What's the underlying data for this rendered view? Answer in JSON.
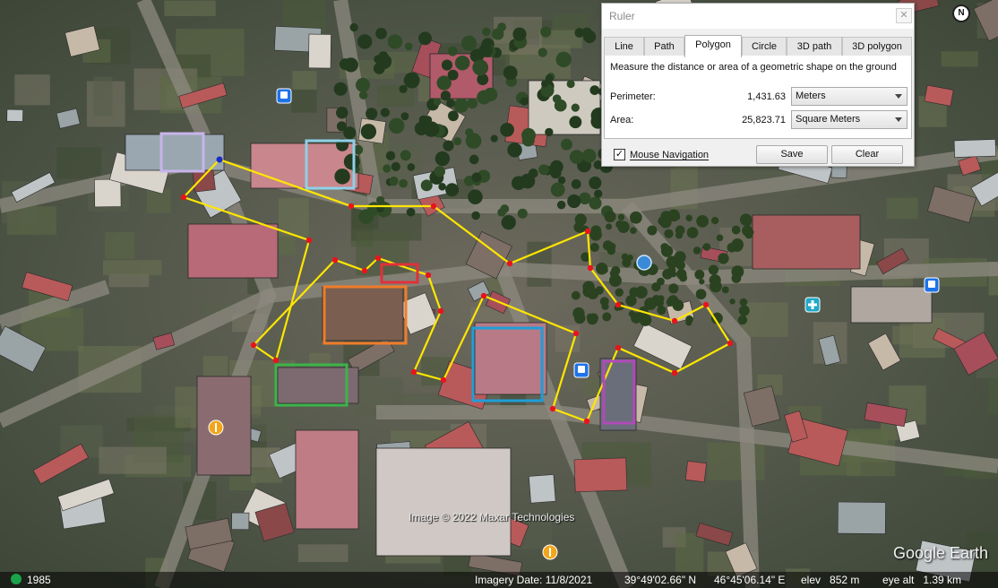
{
  "ruler": {
    "title": "Ruler",
    "close_glyph": "✕",
    "tabs": [
      {
        "label": "Line"
      },
      {
        "label": "Path"
      },
      {
        "label": "Polygon",
        "active": true
      },
      {
        "label": "Circle"
      },
      {
        "label": "3D path"
      },
      {
        "label": "3D polygon"
      }
    ],
    "description": "Measure the distance or area of a geometric shape on the ground",
    "perimeter_label": "Perimeter:",
    "perimeter_value": "1,431.63",
    "perimeter_unit": "Meters",
    "area_label": "Area:",
    "area_value": "25,823.71",
    "area_unit": "Square Meters",
    "mouse_nav_checked": "✓",
    "mouse_nav_label": "Mouse Navigation",
    "save_label": "Save",
    "clear_label": "Clear"
  },
  "map": {
    "compass_label": "N",
    "copyright": "Image © 2022 Maxar Technologies",
    "logo": "Google Earth",
    "polygon_color": "#ffe600",
    "vertex_color": "#e8141c",
    "annotation_colors": [
      "#c8b4ec",
      "#8fd0e8",
      "#e0303a",
      "#f07c2a",
      "#3cb44a",
      "#1e9ed8",
      "#b04ab8"
    ],
    "pois": [
      {
        "icon": "bus-stop-icon"
      },
      {
        "icon": "bus-stop-icon"
      },
      {
        "icon": "bus-stop-icon"
      },
      {
        "icon": "food-icon"
      },
      {
        "icon": "food-icon"
      },
      {
        "icon": "hospital-icon"
      },
      {
        "icon": "landmark-icon"
      }
    ]
  },
  "status": {
    "year": "1985",
    "imagery_date": "Imagery Date: 11/8/2021",
    "lat": "39°49'02.66\" N",
    "lon": "46°45'06.14\" E",
    "elev": "elev   852 m",
    "eye_alt": "eye alt   1.39 km"
  }
}
